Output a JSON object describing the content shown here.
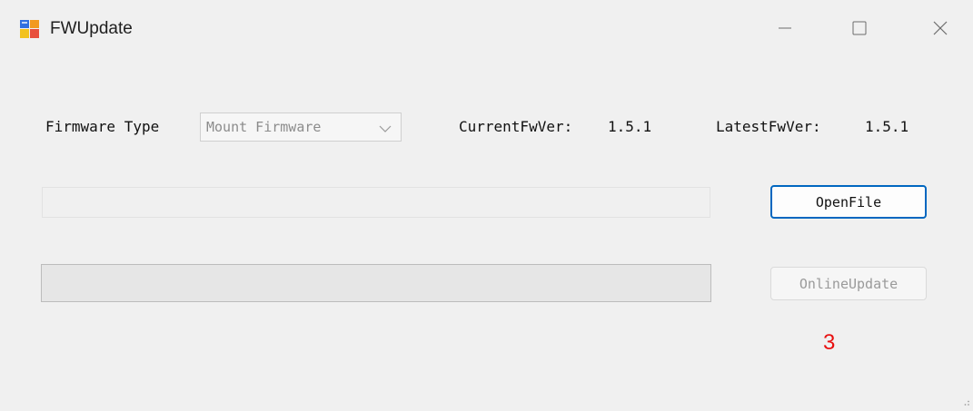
{
  "window": {
    "title": "FWUpdate",
    "icon": "app-window-icon"
  },
  "controls": {
    "minimize": "minimize-icon",
    "maximize": "maximize-icon",
    "close": "close-icon"
  },
  "form": {
    "firmware_type_label": "Firmware Type",
    "firmware_type_value": "Mount Firmware",
    "current_fw_label": "CurrentFwVer:",
    "current_fw_value": "1.5.1",
    "latest_fw_label": "LatestFwVer:",
    "latest_fw_value": "1.5.1",
    "file_path_value": "",
    "progress_fraction": 0
  },
  "buttons": {
    "open_file": "OpenFile",
    "online_update": "OnlineUpdate"
  },
  "status": {
    "counter": "3"
  },
  "colors": {
    "accent": "#0067c0",
    "counter_text": "#e81010"
  }
}
